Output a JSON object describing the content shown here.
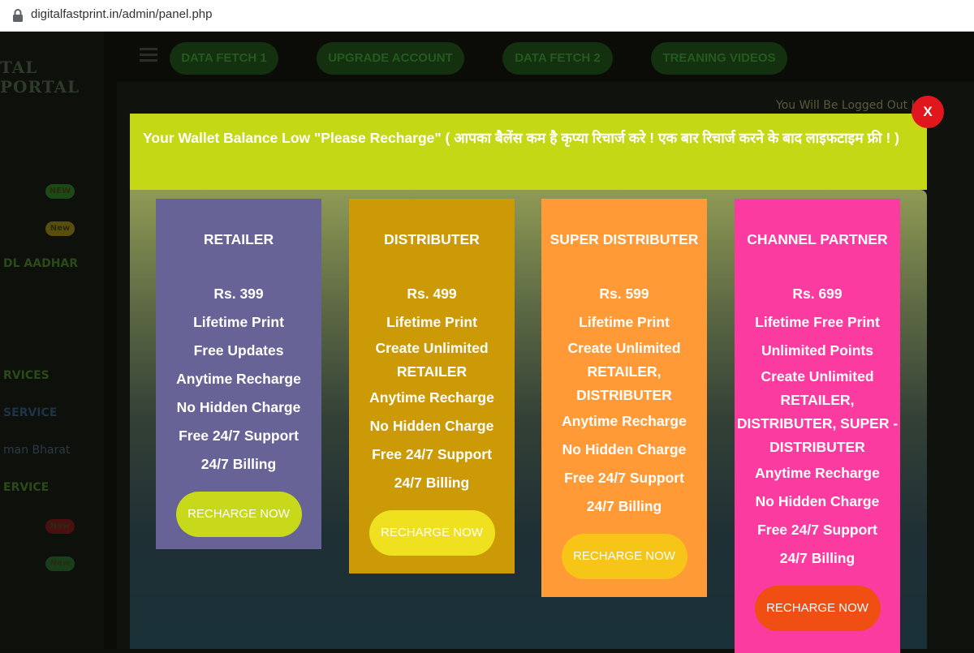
{
  "browser": {
    "url": "digitalfastprint.in/admin/panel.php"
  },
  "background": {
    "brand": "TAL PORTAL",
    "nav_buttons": [
      "DATA FETCH 1",
      "UPGRADE ACCOUNT",
      "DATA FETCH 2",
      "TREANING VIDEOS"
    ],
    "logout_notice": "You Will Be Logged Out In",
    "sidebar_items": [
      {
        "label": "DL AADHAR"
      },
      {
        "label": "RVICES"
      },
      {
        "label": "SERVICE"
      },
      {
        "label": "man Bharat"
      },
      {
        "label": "ERVICE"
      }
    ],
    "badges": [
      "NEW",
      "New",
      "New",
      "New"
    ]
  },
  "modal": {
    "notice": "Your Wallet Balance Low \"Please Recharge\" ( आपका बैलेंस कम है कृप्या रिचार्ज करे ! एक बार रिचार्ज करने के बाद लाइफटाइम फ्री ! )",
    "close_label": "X",
    "plans": [
      {
        "title": "RETAILER",
        "price": "Rs. 399",
        "features": [
          "Lifetime Print",
          "Free Updates",
          "Anytime Recharge",
          "No Hidden Charge",
          "Free 24/7 Support",
          "24/7 Billing"
        ],
        "button": "RECHARGE NOW",
        "bg_color": "#676397",
        "button_color": "#c8d81a"
      },
      {
        "title": "DISTRIBUTER",
        "price": "Rs. 499",
        "features": [
          "Lifetime Print",
          "Create Unlimited RETAILER",
          "Anytime Recharge",
          "No Hidden Charge",
          "Free 24/7 Support",
          "24/7 Billing"
        ],
        "button": "RECHARGE NOW",
        "bg_color": "#cc9a06",
        "button_color": "#f0e120"
      },
      {
        "title": "SUPER DISTRIBUTER",
        "price": "Rs. 599",
        "features": [
          "Lifetime Print",
          "Create Unlimited RETAILER, DISTRIBUTER",
          "Anytime Recharge",
          "No Hidden Charge",
          "Free 24/7 Support",
          "24/7 Billing"
        ],
        "button": "RECHARGE NOW",
        "bg_color": "#ff9a36",
        "button_color": "#f7c418"
      },
      {
        "title": "CHANNEL PARTNER",
        "price": "Rs. 699",
        "features": [
          "Lifetime Free Print",
          "Unlimited Points",
          "Create Unlimited RETAILER, DISTRIBUTER, SUPER - DISTRIBUTER",
          "Anytime Recharge",
          "No Hidden Charge",
          "Free 24/7 Support",
          "24/7 Billing"
        ],
        "button": "RECHARGE NOW",
        "bg_color": "#fb3ba0",
        "button_color": "#f04e12"
      }
    ]
  }
}
